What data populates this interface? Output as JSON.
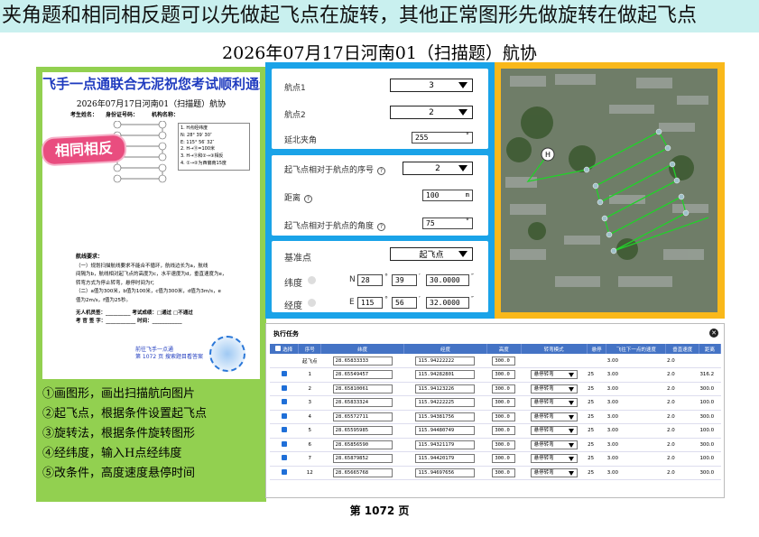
{
  "banner": "夹角题和相同相反题可以先做起飞点在旋转，其他正常图形先做旋转在做起飞点",
  "title": "2026年07月17日河南01（扫描题）航协",
  "exam": {
    "ad": "飞手一点通联合无泥祝您考试顺利通过",
    "title": "2026年07月17日河南01（扫描题）航协",
    "fields": "考生姓名：　　身份证号码：　　　机构名称：",
    "badge": "相同相反",
    "nodes": [
      "⑪",
      "⑩",
      "⑦",
      "⑥",
      "③",
      "②",
      "⑫",
      "⑨",
      "⑧",
      "⑤",
      "④",
      "①"
    ],
    "legend": [
      "1. H点经纬度",
      "N: 28° 39′ 30″",
      "E: 115° 56′ 32″",
      "2. H→⑪=100米",
      "3. H→⑪和②→③相反",
      "4. ①→②为西偏南15度"
    ],
    "req_title": "航线要求：",
    "req": [
      "（一）规划扫描航线要求不能合不循环，航线边长为a，航线",
      "间隔为b，航线相对起飞点的高度为c，水平速度为d，垂直速度为e，",
      "转弯方式为停止转弯，悬停时间为f；",
      "（二）a值为300米，b值为100米，c值为300米，d值为3m/s，e",
      "值为2m/s，f值为25秒。"
    ],
    "sign1": "无人机员签：__________ 考试成绩：□通过 □不通过",
    "sign2": "考 官 签 字：____________ 时间：____________",
    "foot1": "前往飞手一点通",
    "foot2": "第 1072 页  搜索题目看答案"
  },
  "steps": [
    "①画图形，画出扫描航向图片",
    "②起飞点，根据条件设置起飞点",
    "③旋转法，根据条件旋转图形",
    "④经纬度，输入H点经纬度",
    "⑤改条件，高度速度悬停时间"
  ],
  "settings": {
    "wp1_label": "航点1",
    "wp1_value": "3",
    "wp2_label": "航点2",
    "wp2_value": "2",
    "angle_label": "延北夹角",
    "angle_value": "255",
    "angle_unit": "°",
    "takeoff_index_label": "起飞点相对于航点的序号",
    "takeoff_index_value": "2",
    "distance_label": "距离",
    "distance_value": "100",
    "distance_unit": "m",
    "takeoff_angle_label": "起飞点相对于航点的角度",
    "takeoff_angle_value": "75",
    "takeoff_angle_unit": "°",
    "base_label": "基准点",
    "base_value": "起飞点",
    "lat_label": "纬度",
    "lat_hem": "N",
    "lat_deg": "28",
    "lat_min": "39",
    "lat_sec": "30.0000",
    "lon_label": "经度",
    "lon_hem": "E",
    "lon_deg": "115",
    "lon_min": "56",
    "lon_sec": "32.0000",
    "deg_sym": "°",
    "min_sym": "′",
    "sec_sym": "″"
  },
  "task": {
    "title": "执行任务",
    "close": "✕",
    "headers": [
      "选择",
      "序号",
      "纬度",
      "经度",
      "高度",
      "转弯模式",
      "悬停",
      "飞往下一点的速度",
      "垂直速度",
      "距离"
    ],
    "rows": [
      {
        "seq": "起飞点",
        "lat": "28.65833333",
        "lon": "115.94222222",
        "alt": "300.0",
        "mode": "",
        "hover": "",
        "speed": "3.00",
        "vspeed": "2.0",
        "dist": ""
      },
      {
        "seq": "1",
        "lat": "28.65549457",
        "lon": "115.94282801",
        "alt": "300.0",
        "mode": "悬停转弯",
        "hover": "25",
        "speed": "3.00",
        "vspeed": "2.0",
        "dist": "316.2"
      },
      {
        "seq": "2",
        "lat": "28.65810061",
        "lon": "115.94123226",
        "alt": "300.0",
        "mode": "悬停转弯",
        "hover": "25",
        "speed": "3.00",
        "vspeed": "2.0",
        "dist": "300.0"
      },
      {
        "seq": "3",
        "lat": "28.65833324",
        "lon": "115.94222225",
        "alt": "300.0",
        "mode": "悬停转弯",
        "hover": "25",
        "speed": "3.00",
        "vspeed": "2.0",
        "dist": "100.0"
      },
      {
        "seq": "4",
        "lat": "28.65572711",
        "lon": "115.94381756",
        "alt": "300.0",
        "mode": "悬停转弯",
        "hover": "25",
        "speed": "3.00",
        "vspeed": "2.0",
        "dist": "300.0"
      },
      {
        "seq": "5",
        "lat": "28.65595985",
        "lon": "115.94480749",
        "alt": "300.0",
        "mode": "悬停转弯",
        "hover": "25",
        "speed": "3.00",
        "vspeed": "2.0",
        "dist": "100.0"
      },
      {
        "seq": "6",
        "lat": "28.65856590",
        "lon": "115.94321179",
        "alt": "300.0",
        "mode": "悬停转弯",
        "hover": "25",
        "speed": "3.00",
        "vspeed": "2.0",
        "dist": "300.0"
      },
      {
        "seq": "7",
        "lat": "28.65879852",
        "lon": "115.94420179",
        "alt": "300.0",
        "mode": "悬停转弯",
        "hover": "25",
        "speed": "3.00",
        "vspeed": "2.0",
        "dist": "100.0"
      },
      {
        "seq": "12",
        "lat": "28.65665768",
        "lon": "115.94697656",
        "alt": "300.0",
        "mode": "悬停转弯",
        "hover": "25",
        "speed": "3.00",
        "vspeed": "2.0",
        "dist": "300.0"
      }
    ]
  },
  "footer": "第 1072 页",
  "colors": {
    "banner": "#c9f0ef",
    "green": "#92d050",
    "blue": "#1aa3e8",
    "orange": "#f9b81a",
    "header": "#4473c5",
    "route": "#22d12a"
  }
}
